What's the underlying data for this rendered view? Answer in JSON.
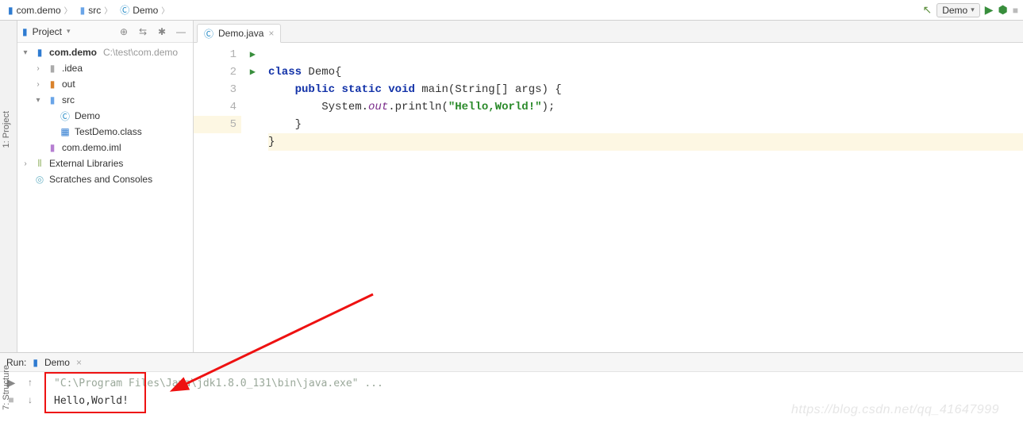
{
  "breadcrumbs": [
    {
      "icon": "module-icon",
      "label": "com.demo"
    },
    {
      "icon": "folder-icon",
      "label": "src"
    },
    {
      "icon": "class-icon",
      "label": "Demo"
    }
  ],
  "run_config": {
    "label": "Demo"
  },
  "project_panel": {
    "title": "Project",
    "tree": {
      "root": {
        "label": "com.demo",
        "hint": "C:\\test\\com.demo"
      },
      "idea": {
        "label": ".idea"
      },
      "out": {
        "label": "out"
      },
      "src": {
        "label": "src"
      },
      "demo_cls": {
        "label": "Demo"
      },
      "test_cls": {
        "label": "TestDemo.class"
      },
      "iml": {
        "label": "com.demo.iml"
      },
      "ext_lib": {
        "label": "External Libraries"
      },
      "scratch": {
        "label": "Scratches and Consoles"
      }
    }
  },
  "editor": {
    "tab_label": "Demo.java",
    "lines": {
      "l1": {
        "num": "1"
      },
      "l2": {
        "num": "2"
      },
      "l3": {
        "num": "3"
      },
      "l4": {
        "num": "4"
      },
      "l5": {
        "num": "5"
      }
    },
    "tok": {
      "class": "class",
      "Demo": "Demo",
      "lb": "{",
      "public": "public",
      "static": "static",
      "void": "void",
      "mainSig": " main(String[] args) {",
      "sysout_pfx": "        System.",
      "out": "out",
      "println_pfx": ".println(",
      "hello": "\"Hello,World!\"",
      "println_sfx": ");",
      "rb_inner": "    }",
      "rb_outer": "}"
    }
  },
  "run_tool": {
    "title": "Run:",
    "tab_label": "Demo",
    "out_cmd": "\"C:\\Program Files\\Java\\jdk1.8.0_131\\bin\\java.exe\" ...",
    "out_line": "Hello,World!"
  },
  "vtabs": {
    "project": "1: Project",
    "structure": "7: Structure"
  },
  "watermark": "https://blog.csdn.net/qq_41647999"
}
